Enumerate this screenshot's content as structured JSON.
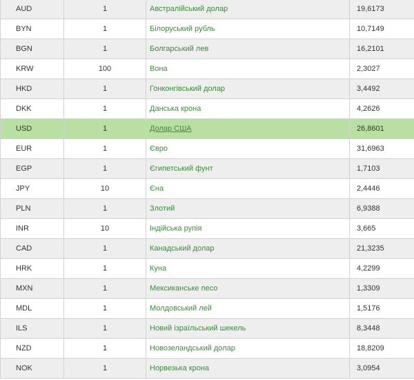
{
  "table": {
    "highlight_color": "#b9dfa3",
    "link_color": "#3c8a3c",
    "rows": [
      {
        "code": "AUD",
        "units": "1",
        "name": "Австралійський долар",
        "rate": "19,6173"
      },
      {
        "code": "BYN",
        "units": "1",
        "name": "Білоруський рубль",
        "rate": "10,7149"
      },
      {
        "code": "BGN",
        "units": "1",
        "name": "Болгарський лев",
        "rate": "16,2101"
      },
      {
        "code": "KRW",
        "units": "100",
        "name": "Вона",
        "rate": "2,3027"
      },
      {
        "code": "HKD",
        "units": "1",
        "name": "Гонконгівський долар",
        "rate": "3,4492"
      },
      {
        "code": "DKK",
        "units": "1",
        "name": "Данська крона",
        "rate": "4,2626"
      },
      {
        "code": "USD",
        "units": "1",
        "name": "Долар США",
        "rate": "26,8601",
        "highlighted": true
      },
      {
        "code": "EUR",
        "units": "1",
        "name": "Євро",
        "rate": "31,6963"
      },
      {
        "code": "EGP",
        "units": "1",
        "name": "Єгипетський фунт",
        "rate": "1,7103"
      },
      {
        "code": "JPY",
        "units": "10",
        "name": "Єна",
        "rate": "2,4446"
      },
      {
        "code": "PLN",
        "units": "1",
        "name": "Злотий",
        "rate": "6,9388"
      },
      {
        "code": "INR",
        "units": "10",
        "name": "Індійська рупія",
        "rate": "3,665"
      },
      {
        "code": "CAD",
        "units": "1",
        "name": "Канадський долар",
        "rate": "21,3235"
      },
      {
        "code": "HRK",
        "units": "1",
        "name": "Куна",
        "rate": "4,2299"
      },
      {
        "code": "MXN",
        "units": "1",
        "name": "Мексиканське песо",
        "rate": "1,3309"
      },
      {
        "code": "MDL",
        "units": "1",
        "name": "Молдовський лей",
        "rate": "1,5176"
      },
      {
        "code": "ILS",
        "units": "1",
        "name": "Новий ізраїльський шекель",
        "rate": "8,3448"
      },
      {
        "code": "NZD",
        "units": "1",
        "name": "Новозеландський долар",
        "rate": "18,8209"
      },
      {
        "code": "NOK",
        "units": "1",
        "name": "Норвезька крона",
        "rate": "3,0954"
      }
    ]
  }
}
